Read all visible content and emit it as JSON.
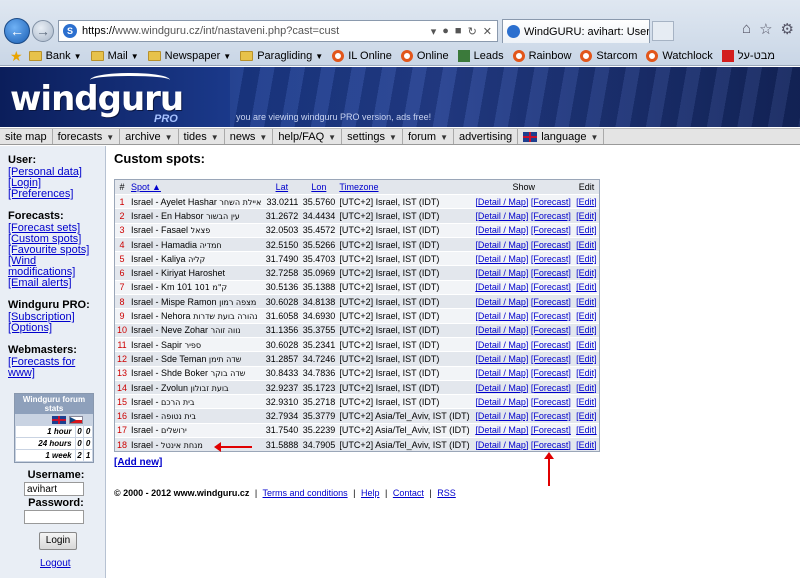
{
  "browser": {
    "url_scheme": "https://",
    "url_rest": "www.windguru.cz/int/nastaveni.php?cast=cust",
    "tab_title": "WindGURU: avihart: User se...",
    "favorites": [
      {
        "label": "Bank",
        "icon": "folder-icon",
        "dropdown": true
      },
      {
        "label": "Mail",
        "icon": "folder-icon",
        "dropdown": true
      },
      {
        "label": "Newspaper",
        "icon": "folder-icon",
        "dropdown": true
      },
      {
        "label": "Paragliding",
        "icon": "folder-icon",
        "dropdown": true
      },
      {
        "label": "IL Online",
        "icon": "ring-icon",
        "dropdown": false
      },
      {
        "label": "Online",
        "icon": "ring-icon",
        "dropdown": false
      },
      {
        "label": "Leads",
        "icon": "leads-icon",
        "dropdown": false
      },
      {
        "label": "Rainbow",
        "icon": "ring-icon",
        "dropdown": false
      },
      {
        "label": "Starcom",
        "icon": "ring-icon",
        "dropdown": false
      },
      {
        "label": "Watchlock",
        "icon": "ring-icon",
        "dropdown": false
      },
      {
        "label": "מבט-על",
        "icon": "red-square-icon",
        "dropdown": false
      }
    ]
  },
  "banner": {
    "logo": "windguru",
    "pro": "PRO",
    "message": "you are viewing windguru PRO version, ads free!"
  },
  "menu": [
    {
      "label": "site map",
      "dropdown": false
    },
    {
      "label": "forecasts",
      "dropdown": true
    },
    {
      "label": "archive",
      "dropdown": true
    },
    {
      "label": "tides",
      "dropdown": true
    },
    {
      "label": "news",
      "dropdown": true
    },
    {
      "label": "help/FAQ",
      "dropdown": true
    },
    {
      "label": "settings",
      "dropdown": true
    },
    {
      "label": "forum",
      "dropdown": true
    },
    {
      "label": "advertising",
      "dropdown": false
    },
    {
      "label": "language",
      "dropdown": true
    }
  ],
  "sidebar": {
    "user_heading": "User:",
    "user_links": [
      "[Personal data]",
      "[Login]",
      "[Preferences]"
    ],
    "forecasts_heading": "Forecasts:",
    "forecasts_links": [
      "[Forecast sets]",
      "[Custom spots]",
      "[Favourite spots]",
      "[Wind modifications]",
      "[Email alerts]"
    ],
    "pro_heading": "Windguru PRO:",
    "pro_links": [
      "[Subscription]",
      "[Options]"
    ],
    "webmasters_heading": "Webmasters:",
    "webmasters_links": [
      "[Forecasts for www]"
    ],
    "stats": {
      "title": "Windguru forum stats",
      "rows": [
        {
          "label": "1 hour",
          "uk": "0",
          "cz": "0"
        },
        {
          "label": "24 hours",
          "uk": "0",
          "cz": "0"
        },
        {
          "label": "1 week",
          "uk": "2",
          "cz": "1"
        }
      ]
    },
    "username_label": "Username:",
    "username_value": "avihart",
    "password_label": "Password:",
    "login_button": "Login",
    "logout": "Logout"
  },
  "main": {
    "title": "Custom spots:",
    "columns": {
      "num": "#",
      "spot": "Spot ▲",
      "lat": "Lat",
      "lon": "Lon",
      "timezone": "Timezone",
      "show": "Show",
      "edit": "Edit"
    },
    "link_detail": "[Detail / Map]",
    "link_forecast": "[Forecast]",
    "link_edit": "[Edit]",
    "rows": [
      {
        "num": "1",
        "spot": "Israel - Ayelet Hashar",
        "heb": "איילת השחר",
        "lat": "33.0211",
        "lon": "35.5760",
        "tz": "[UTC+2] Israel, IST (IDT)"
      },
      {
        "num": "2",
        "spot": "Israel - En Habsor",
        "heb": "עין הבשור",
        "lat": "31.2672",
        "lon": "34.4434",
        "tz": "[UTC+2] Israel, IST (IDT)"
      },
      {
        "num": "3",
        "spot": "Israel - Fasael",
        "heb": "פצאל",
        "lat": "32.0503",
        "lon": "35.4572",
        "tz": "[UTC+2] Israel, IST (IDT)"
      },
      {
        "num": "4",
        "spot": "Israel - Hamadia",
        "heb": "חמדיה",
        "lat": "32.5150",
        "lon": "35.5266",
        "tz": "[UTC+2] Israel, IST (IDT)"
      },
      {
        "num": "5",
        "spot": "Israel - Kaliya",
        "heb": "קליה",
        "lat": "31.7490",
        "lon": "35.4703",
        "tz": "[UTC+2] Israel, IST (IDT)"
      },
      {
        "num": "6",
        "spot": "Israel - Kiriyat Haroshet",
        "heb": "",
        "lat": "32.7258",
        "lon": "35.0969",
        "tz": "[UTC+2] Israel, IST (IDT)"
      },
      {
        "num": "7",
        "spot": "Israel - Km 101",
        "heb": "ק\"מ 101",
        "lat": "30.5136",
        "lon": "35.1388",
        "tz": "[UTC+2] Israel, IST (IDT)"
      },
      {
        "num": "8",
        "spot": "Israel - Mispe Ramon",
        "heb": "מצפה רמון",
        "lat": "30.6028",
        "lon": "34.8138",
        "tz": "[UTC+2] Israel, IST (IDT)"
      },
      {
        "num": "9",
        "spot": "Israel - Nehora",
        "heb": "נהורה בועת שדרות",
        "lat": "31.6058",
        "lon": "34.6930",
        "tz": "[UTC+2] Israel, IST (IDT)"
      },
      {
        "num": "10",
        "spot": "Israel - Neve Zohar",
        "heb": "נווה זוהר",
        "lat": "31.1356",
        "lon": "35.3755",
        "tz": "[UTC+2] Israel, IST (IDT)"
      },
      {
        "num": "11",
        "spot": "Israel - Sapir",
        "heb": "ספיר",
        "lat": "30.6028",
        "lon": "35.2341",
        "tz": "[UTC+2] Israel, IST (IDT)"
      },
      {
        "num": "12",
        "spot": "Israel - Sde Teman",
        "heb": "שדה תימן",
        "lat": "31.2857",
        "lon": "34.7246",
        "tz": "[UTC+2] Israel, IST (IDT)"
      },
      {
        "num": "13",
        "spot": "Israel - Shde Boker",
        "heb": "שדה בוקר",
        "lat": "30.8433",
        "lon": "34.7836",
        "tz": "[UTC+2] Israel, IST (IDT)"
      },
      {
        "num": "14",
        "spot": "Israel - Zvolun",
        "heb": "בועת זבולון",
        "lat": "32.9237",
        "lon": "35.1723",
        "tz": "[UTC+2] Israel, IST (IDT)"
      },
      {
        "num": "15",
        "spot": "Israel -",
        "heb": "בית הרכם",
        "lat": "32.9310",
        "lon": "35.2718",
        "tz": "[UTC+2] Israel, IST (IDT)"
      },
      {
        "num": "16",
        "spot": "Israel -",
        "heb": "בית נטופה",
        "lat": "32.7934",
        "lon": "35.3779",
        "tz": "[UTC+2] Asia/Tel_Aviv, IST (IDT)"
      },
      {
        "num": "17",
        "spot": "Israel -",
        "heb": "ירושלים",
        "lat": "31.7540",
        "lon": "35.2239",
        "tz": "[UTC+2] Asia/Tel_Aviv, IST (IDT)"
      },
      {
        "num": "18",
        "spot": "Israel -",
        "heb": "מנחת אינטל",
        "lat": "31.5888",
        "lon": "34.7905",
        "tz": "[UTC+2] Asia/Tel_Aviv, IST (IDT)"
      }
    ],
    "add_new": "[Add new]"
  },
  "footer": {
    "copyright": "© 2000 - 2012 www.windguru.cz",
    "links": [
      "Terms and conditions",
      "Help",
      "Contact",
      "RSS"
    ]
  },
  "colors": {
    "link": "#0000cc",
    "row_number": "#cc0000",
    "annotation": "#e00000",
    "banner": "#1b3a8c"
  }
}
